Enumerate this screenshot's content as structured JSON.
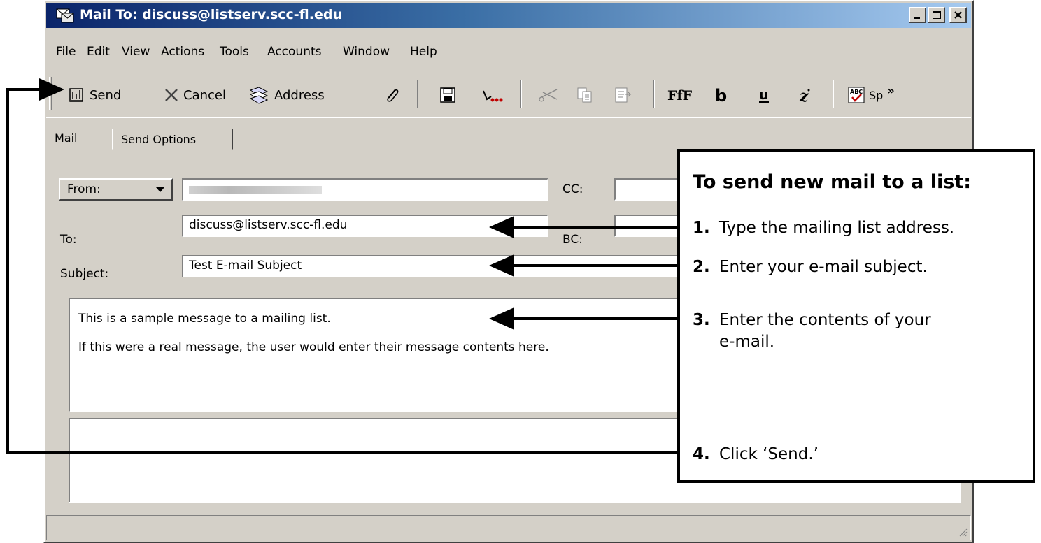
{
  "window": {
    "title": "Mail To: discuss@listserv.scc-fl.edu"
  },
  "menu": [
    "File",
    "Edit",
    "View",
    "Actions",
    "Tools",
    "Accounts",
    "Window",
    "Help"
  ],
  "toolbar": {
    "send": "Send",
    "cancel": "Cancel",
    "address": "Address",
    "spell": "Sp"
  },
  "tabs": [
    "Mail",
    "Send Options"
  ],
  "form": {
    "from_label": "From:",
    "to_label": "To:",
    "to_value": "discuss@listserv.scc-fl.edu",
    "subject_label": "Subject:",
    "subject_value": "Test E-mail Subject",
    "cc_label": "CC:",
    "bc_label": "BC:"
  },
  "message": {
    "line1": "This is a sample message to a mailing list.",
    "line2": "If this were a real message, the user would enter their message contents here."
  },
  "callout": {
    "heading": "To send new mail to a list:",
    "steps": [
      {
        "num": "1.",
        "text": "Type the mailing list address."
      },
      {
        "num": "2.",
        "text": "Enter your e-mail subject."
      },
      {
        "num": "3.",
        "text": "Enter the contents of your",
        "text2": "e-mail."
      },
      {
        "num": "4.",
        "text": "Click ‘Send.’"
      }
    ]
  },
  "icons": [
    "mail-window-icon",
    "send-icon",
    "cancel-icon",
    "address-book-icon",
    "attach-icon",
    "save-icon",
    "bell-icon",
    "cut-icon",
    "copy-icon",
    "paste-icon",
    "font-icon",
    "bold-icon",
    "underline-icon",
    "italic-icon",
    "spellcheck-icon"
  ]
}
